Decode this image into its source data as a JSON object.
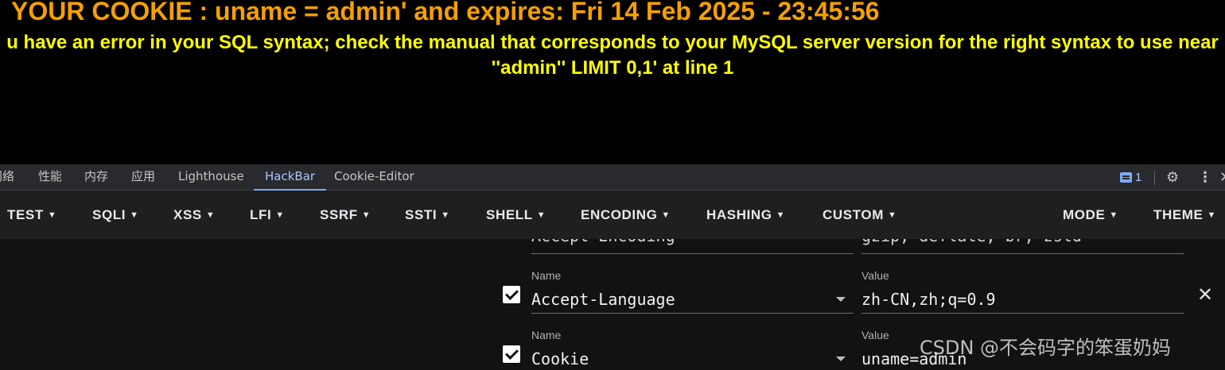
{
  "page": {
    "cookie_line": "YOUR COOKIE : uname = admin' and expires: Fri 14 Feb 2025 - 23:45:56",
    "sql_error": "u have an error in your SQL syntax; check the manual that corresponds to your MySQL server version for the right syntax to use near ''admin'' LIMIT 0,1' at line 1"
  },
  "devtools": {
    "tabs": [
      {
        "label": "网络"
      },
      {
        "label": "性能"
      },
      {
        "label": "内存"
      },
      {
        "label": "应用"
      },
      {
        "label": "Lighthouse"
      },
      {
        "label": "HackBar",
        "active": true
      },
      {
        "label": "Cookie-Editor"
      }
    ],
    "message_count": "1"
  },
  "hackbar": {
    "menu": [
      "TEST",
      "SQLI",
      "XSS",
      "LFI",
      "SSRF",
      "SSTI",
      "SHELL",
      "ENCODING",
      "HASHING",
      "CUSTOM"
    ],
    "menu_right": [
      "MODE",
      "THEME"
    ],
    "headers": [
      {
        "name": "Accept-Encoding",
        "value": "gzip, deflate, br, zstd",
        "partial": true
      },
      {
        "name_label": "Name",
        "value_label": "Value",
        "name": "Accept-Language",
        "value": "zh-CN,zh;q=0.9",
        "checked": true
      },
      {
        "name_label": "Name",
        "value_label": "Value",
        "name": "Cookie",
        "value": "uname=admin",
        "checked": true
      }
    ]
  },
  "watermark": "CSDN @不会码字的笨蛋奶妈",
  "colors": {
    "cookie_text": "#f5a000",
    "error_text": "#ffff00",
    "active_tab": "#a8c7fa"
  }
}
